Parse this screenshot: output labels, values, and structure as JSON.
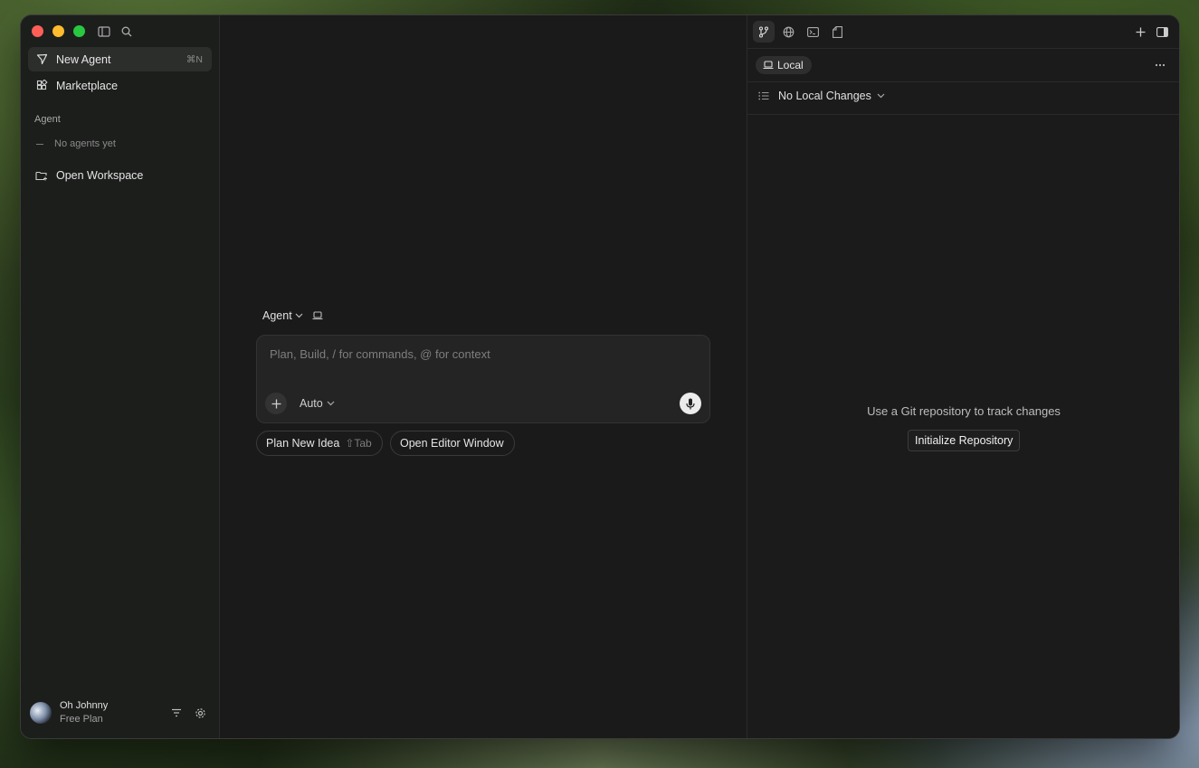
{
  "sidebar": {
    "items": [
      {
        "label": "New Agent",
        "shortcut": "⌘N",
        "icon": "send-icon"
      },
      {
        "label": "Marketplace",
        "icon": "marketplace-icon"
      }
    ],
    "section_label": "Agent",
    "empty_text": "No agents yet",
    "open_workspace": "Open Workspace",
    "user": {
      "name": "Oh Johnny",
      "plan": "Free Plan"
    }
  },
  "composer": {
    "mode": "Agent",
    "placeholder": "Plan, Build, / for commands, @ for context",
    "model": "Auto"
  },
  "chips": {
    "plan_label": "Plan New Idea",
    "plan_hint": "⇧Tab",
    "editor_label": "Open Editor Window"
  },
  "right_panel": {
    "local_label": "Local",
    "changes_label": "No Local Changes",
    "git_message": "Use a Git repository to track changes",
    "init_button": "Initialize Repository"
  },
  "colors": {
    "close": "#ff5f57",
    "minimize": "#febc2e",
    "zoom": "#28c840",
    "window_bg": "#1b1b1b"
  }
}
